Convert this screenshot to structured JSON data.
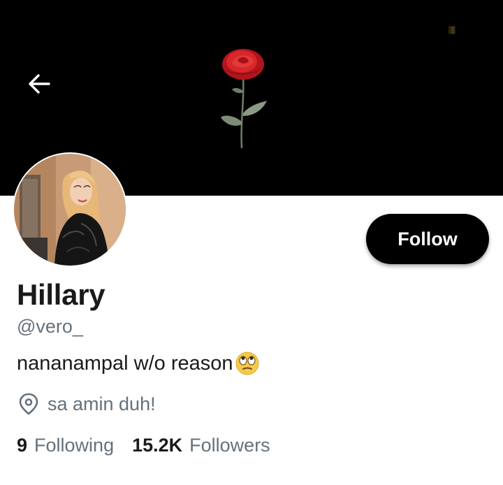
{
  "header": {
    "back_icon": "arrow-left-icon",
    "banner_image": "red-rose-on-black"
  },
  "profile": {
    "display_name": "Hillary",
    "handle": "@vero_",
    "bio": "nananampal w/o reason",
    "bio_emoji": "face-with-rolling-eyes-emoji",
    "location_icon": "location-pin-icon",
    "location": "sa amin duh!",
    "following_count": "9",
    "following_label": "Following",
    "followers_count": "15.2K",
    "followers_label": "Followers"
  },
  "actions": {
    "follow_label": "Follow"
  },
  "colors": {
    "banner_bg": "#000000",
    "button_bg": "#000000",
    "button_text": "#ffffff",
    "primary_text": "#1a1a1a",
    "secondary_text": "#65717b"
  }
}
